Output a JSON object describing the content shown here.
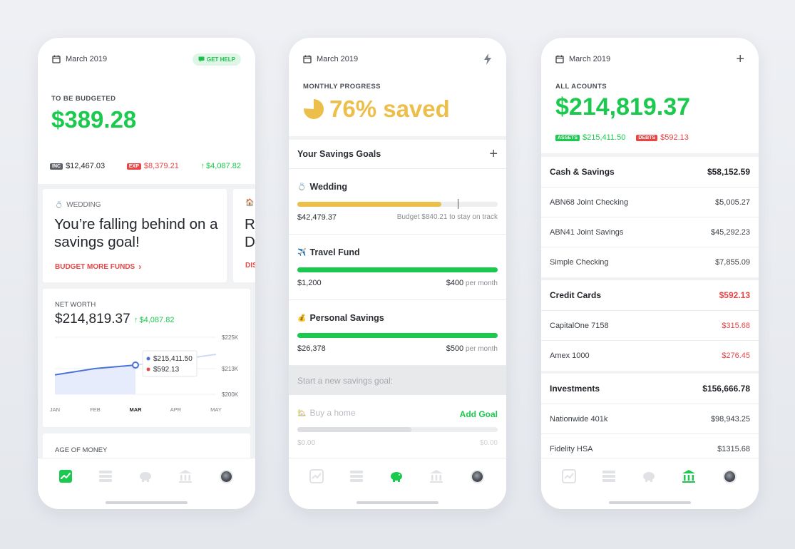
{
  "phone1": {
    "month": "March 2019",
    "help_label": "GET HELP",
    "budget_label": "TO BE BUDGETED",
    "budget_amount": "$389.28",
    "income_tag": "INC",
    "income": "$12,467.03",
    "expense_tag": "EXP",
    "expense": "$8,379.21",
    "net_change": "$4,087.82",
    "alert": {
      "label": "WEDDING",
      "title": "You’re falling behind on a savings goal!",
      "action": "BUDGET MORE FUNDS"
    },
    "alert2": {
      "title_partial": "R D",
      "action_partial": "DIS"
    },
    "networth": {
      "label": "NET WORTH",
      "amount": "$214,819.37",
      "change": "$4,087.82",
      "tooltip_assets": "$215,411.50",
      "tooltip_debts": "$592.13"
    },
    "age_label": "AGE OF MONEY"
  },
  "chart_data": {
    "type": "line",
    "categories": [
      "JAN",
      "FEB",
      "MAR",
      "APR",
      "MAY"
    ],
    "series": [
      {
        "values": [
          208500,
          211300,
          212800,
          null,
          null
        ]
      },
      {
        "values": [
          null,
          null,
          212800,
          215000,
          217500
        ]
      }
    ],
    "y_ticks": [
      "$225K",
      "$213K",
      "$200K"
    ],
    "ylim": [
      200000,
      225000
    ],
    "highlight_category": "MAR",
    "tooltip": [
      "$215,411.50",
      "$592.13"
    ]
  },
  "phone2": {
    "month": "March 2019",
    "progress_label": "MONTHLY PROGRESS",
    "progress_text": "76% saved",
    "progress_fraction": 0.76,
    "goals_title": "Your Savings Goals",
    "goals": [
      {
        "name": "Wedding",
        "emoji": "💍",
        "amount": "$42,479.37",
        "right": "Budget $840.21 to stay on track",
        "fill": 0.72,
        "marker": 0.8,
        "color": "#ecbe4a"
      },
      {
        "name": "Travel Fund",
        "emoji": "✈️",
        "amount": "$1,200",
        "right_value": "$400",
        "right_unit": "per month",
        "fill": 1.0,
        "color": "#1bc94e"
      },
      {
        "name": "Personal Savings",
        "emoji": "💰",
        "amount": "$26,378",
        "right_value": "$500",
        "right_unit": "per month",
        "fill": 1.0,
        "color": "#1bc94e"
      }
    ],
    "new_goal_prompt": "Start a new savings goal:",
    "new_goal": {
      "name": "Buy a home",
      "emoji": "🏡",
      "add_label": "Add Goal",
      "left": "$0.00",
      "right": "$0.00",
      "fill": 0.57
    }
  },
  "phone3": {
    "month": "March 2019",
    "accounts_label": "ALL ACOUNTS",
    "total": "$214,819.37",
    "assets_tag": "ASSETS",
    "assets": "$215,411.50",
    "debts_tag": "DEBTS",
    "debts": "$592.13",
    "sections": [
      {
        "title": "Cash & Savings",
        "total": "$58,152.59",
        "negative": false,
        "rows": [
          {
            "name": "ABN68 Joint Checking",
            "value": "$5,005.27"
          },
          {
            "name": "ABN41 Joint Savings",
            "value": "$45,292.23"
          },
          {
            "name": "Simple Checking",
            "value": "$7,855.09"
          }
        ]
      },
      {
        "title": "Credit Cards",
        "total": "$592.13",
        "negative": true,
        "rows": [
          {
            "name": "CapitalOne 7158",
            "value": "$315.68"
          },
          {
            "name": "Amex 1000",
            "value": "$276.45"
          }
        ]
      },
      {
        "title": "Investments",
        "total": "$156,666.78",
        "negative": false,
        "rows": [
          {
            "name": "Nationwide 401k",
            "value": "$98,943.25"
          },
          {
            "name": "Fidelity HSA",
            "value": "$1315.68"
          }
        ]
      }
    ]
  },
  "tabs": [
    "trends-icon",
    "budget-icon",
    "savings-icon",
    "accounts-icon",
    "profile-avatar"
  ],
  "colors": {
    "green": "#1bc94e",
    "red": "#e84545",
    "gold": "#ecbe4a",
    "chart_blue": "#4a72d8"
  }
}
